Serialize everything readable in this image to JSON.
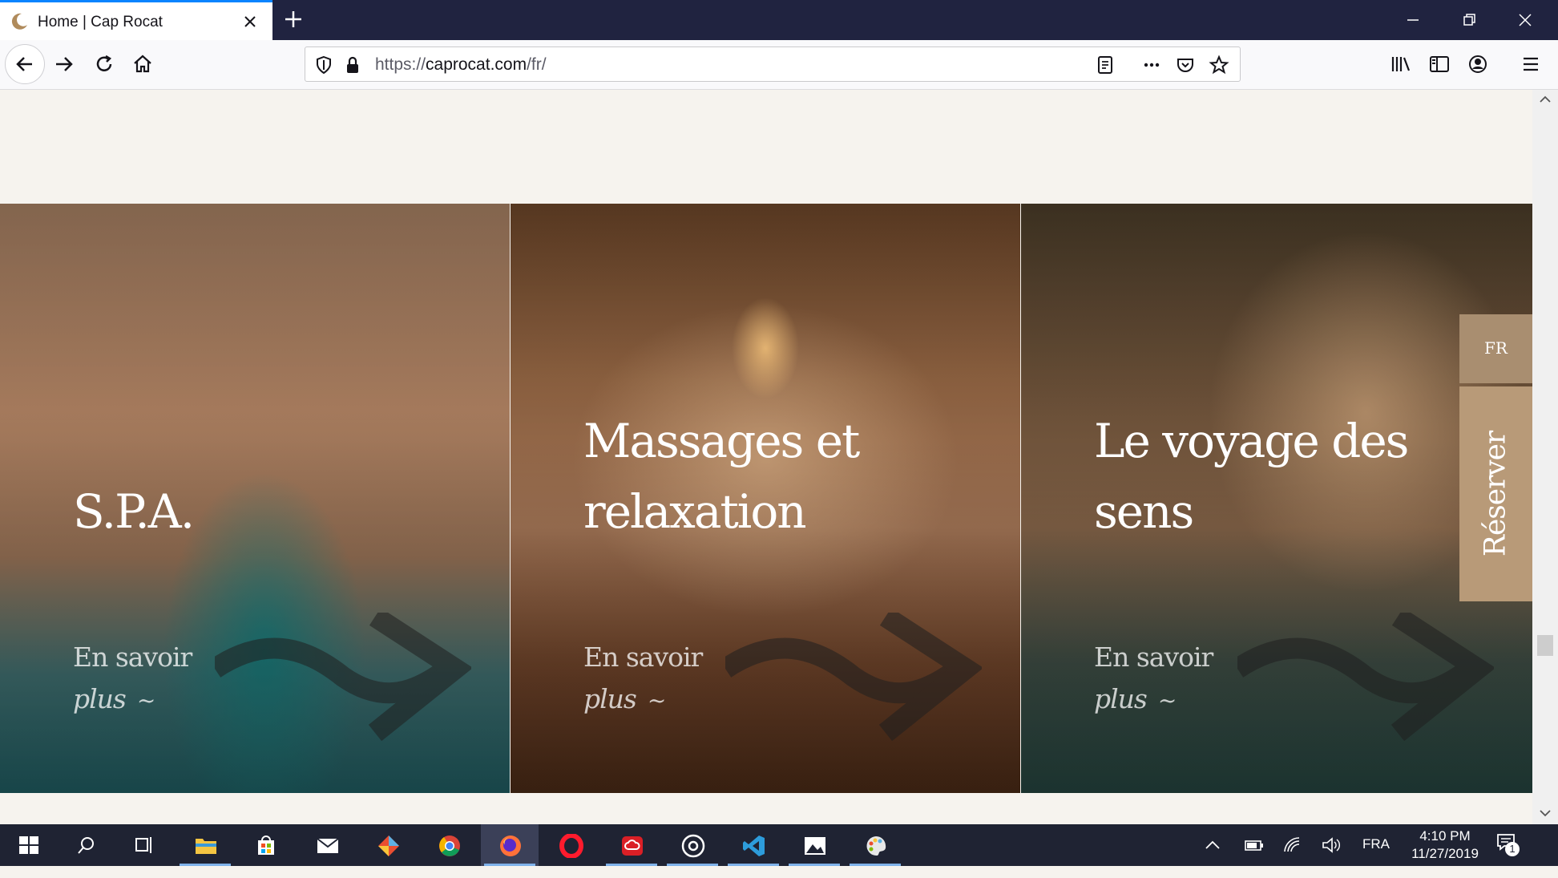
{
  "browser": {
    "tab_title": "Home | Cap Rocat",
    "url_prefix": "https://",
    "url_host": "caprocat.com",
    "url_path": "/fr/"
  },
  "panels": [
    {
      "title_lines": [
        "S.P.A."
      ],
      "link_line1": "En savoir",
      "link_line2": "plus",
      "link_icon": "~"
    },
    {
      "title_lines": [
        "Massages et",
        "relaxation"
      ],
      "link_line1": "En savoir",
      "link_line2": "plus",
      "link_icon": "~"
    },
    {
      "title_lines": [
        "Le voyage des",
        "sens"
      ],
      "link_line1": "En savoir",
      "link_line2": "plus",
      "link_icon": "~"
    }
  ],
  "side": {
    "language": "FR",
    "reserve": "Réserver"
  },
  "taskbar": {
    "language": "FRA",
    "time": "4:10 PM",
    "date": "11/27/2019",
    "notifications": "1"
  },
  "colors": {
    "titlebar": "#202340",
    "tab_accent": "#0a84ff",
    "page_bg": "#f6f3ee",
    "lang_btn": "#a98e70",
    "reserve_btn": "#b89a78",
    "taskbar": "#1f2333"
  }
}
